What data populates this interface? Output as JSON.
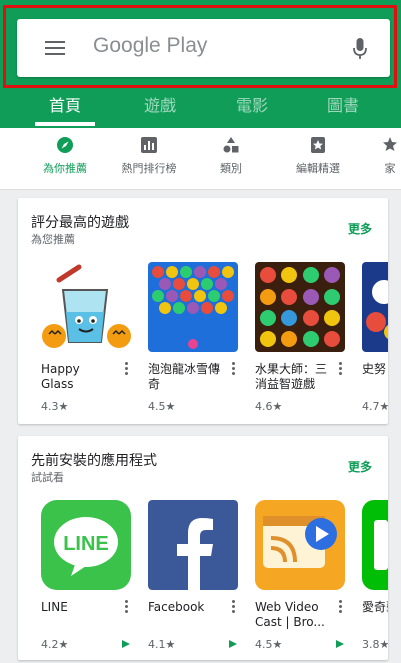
{
  "search": {
    "title": "Google Play"
  },
  "tabs": [
    {
      "label": "首頁",
      "active": true
    },
    {
      "label": "遊戲"
    },
    {
      "label": "電影"
    },
    {
      "label": "圖書"
    }
  ],
  "subnav": [
    {
      "label": "為你推薦",
      "icon": "compass-icon",
      "active": true
    },
    {
      "label": "熱門排行榜",
      "icon": "chart-icon"
    },
    {
      "label": "類別",
      "icon": "categories-icon"
    },
    {
      "label": "編輯精選",
      "icon": "editors-choice-icon"
    },
    {
      "label": "家",
      "icon": "family-icon"
    }
  ],
  "sections": [
    {
      "title": "評分最高的遊戲",
      "subtitle": "為您推薦",
      "more": "更多",
      "apps": [
        {
          "name": "Happy Glass",
          "rating": "4.3★",
          "icon": "happy-glass-icon"
        },
        {
          "name": "泡泡龍冰雪傳奇",
          "rating": "4.5★",
          "icon": "bubble-game-icon"
        },
        {
          "name": "水果大師：三消益智遊戲",
          "rating": "4.6★",
          "icon": "fruit-master-icon"
        },
        {
          "name": "史努",
          "rating": "4.7★",
          "icon": "snoopy-icon"
        }
      ]
    },
    {
      "title": "先前安裝的應用程式",
      "subtitle": "試試看",
      "more": "更多",
      "apps": [
        {
          "name": "LINE",
          "rating": "4.2★",
          "icon": "line-icon"
        },
        {
          "name": "Facebook",
          "rating": "4.1★",
          "icon": "facebook-icon"
        },
        {
          "name": "Web Video Cast | Bro...",
          "rating": "4.5★",
          "icon": "web-video-cast-icon"
        },
        {
          "name": "愛奇藝專用",
          "rating": "3.8★",
          "icon": "iqiyi-icon"
        }
      ]
    }
  ],
  "colors": {
    "accent": "#0f9d58",
    "highlight": "#e01010"
  }
}
